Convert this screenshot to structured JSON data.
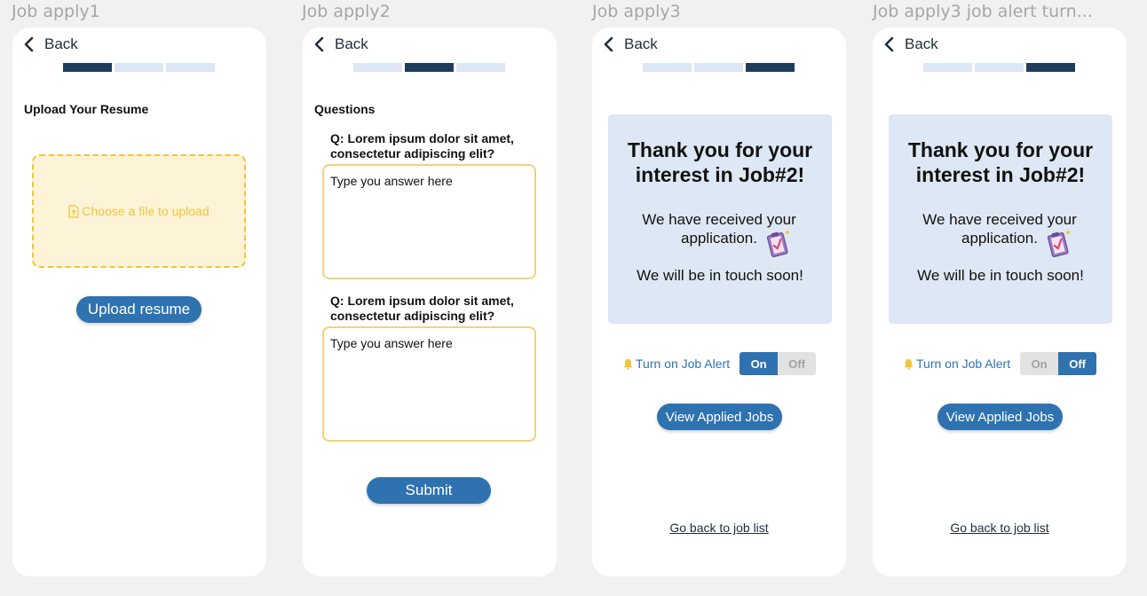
{
  "frames": [
    {
      "title": "Job apply1"
    },
    {
      "title": "Job apply2"
    },
    {
      "title": "Job apply3"
    },
    {
      "title": "Job apply3 job alert turn..."
    }
  ],
  "back_label": "Back",
  "upload": {
    "section_title": "Upload Your Resume",
    "dropzone_label": "Choose a file to upload",
    "button_label": "Upload resume"
  },
  "questions": {
    "section_title": "Questions",
    "items": [
      {
        "question": "Q: Lorem ipsum dolor sit amet, consectetur adipiscing elit?",
        "answer_placeholder": "Type you answer here"
      },
      {
        "question": "Q: Lorem ipsum dolor sit amet, consectetur adipiscing elit?",
        "answer_placeholder": "Type you answer here"
      }
    ],
    "submit_label": "Submit"
  },
  "confirmation": {
    "title": "Thank you for your interest in Job#2!",
    "received": "We have received your application.",
    "touch": "We will be in touch soon!",
    "alert_label": "Turn on Job Alert",
    "on_label": "On",
    "off_label": "Off",
    "view_button_label": "View Applied Jobs",
    "go_back_link": "Go back to job list"
  },
  "colors": {
    "accent": "#2f72b0",
    "progress_active": "#1e3d5e",
    "progress_inactive": "#dde6f3",
    "dropzone_border": "#f0c53a",
    "card_background": "#dee8f4"
  }
}
